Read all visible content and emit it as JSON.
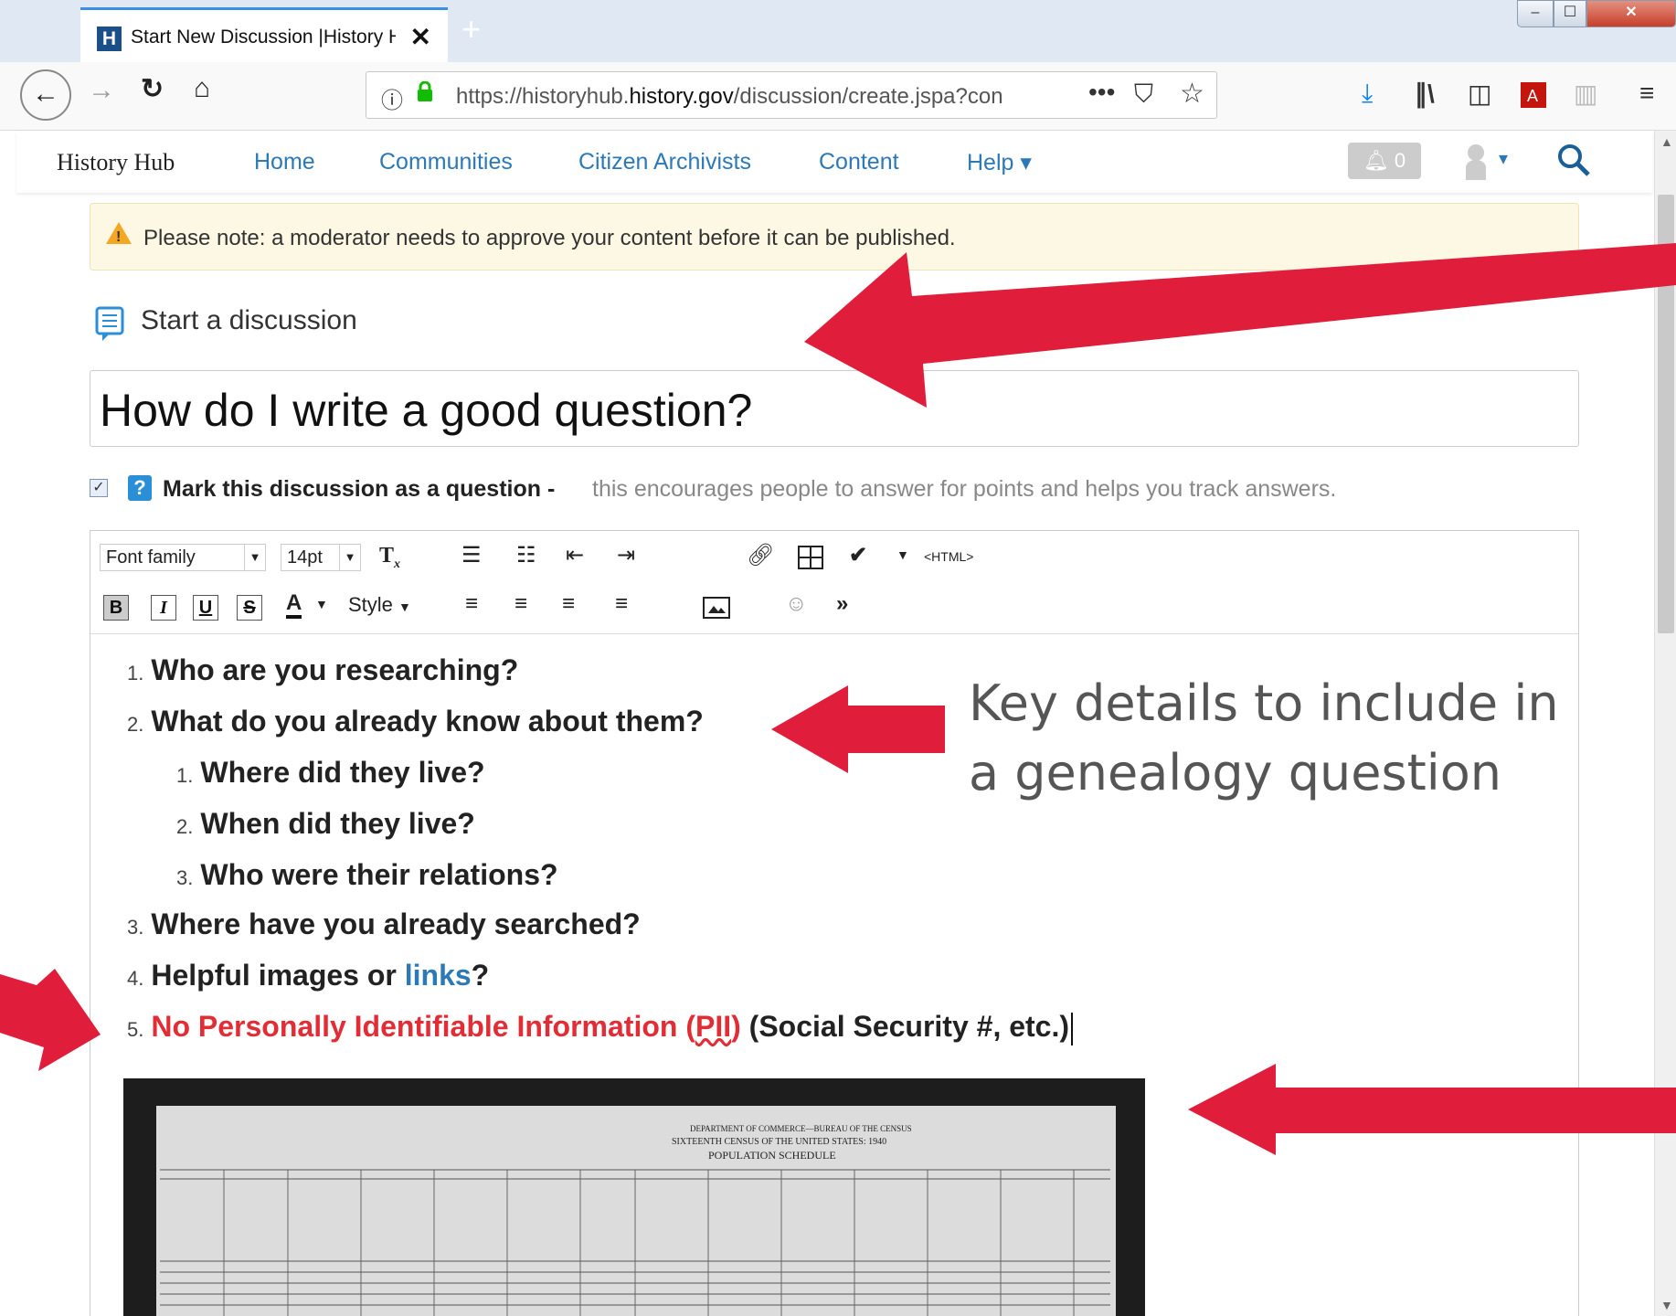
{
  "browser": {
    "tab_title": "Start New Discussion |History Hub",
    "favicon_letter": "H",
    "tab_close": "✕",
    "new_tab": "+",
    "window_controls": [
      "–",
      "☐",
      "✕"
    ],
    "url_prefix": "https://historyhub.",
    "url_domain": "history.gov",
    "url_path": "/discussion/create.jspa?con",
    "icons": [
      "back-icon",
      "forward-icon",
      "reload-icon",
      "home-icon",
      "info-icon",
      "lock-icon",
      "more-icon",
      "pocket-icon",
      "star-icon",
      "download-icon",
      "library-icon",
      "sidebar-icon",
      "pdf-icon",
      "reader-icon",
      "menu-icon"
    ]
  },
  "site": {
    "brand": "History Hub",
    "nav": [
      "Home",
      "Communities",
      "Citizen Archivists",
      "Content",
      "Help"
    ],
    "notifications": "0"
  },
  "notice": "Please note: a moderator needs to approve your content before it can be published.",
  "section_title": "Start a discussion",
  "subject": "How do I write a good question?",
  "question_checkbox": {
    "checked": true,
    "label": "Mark this discussion as a question -",
    "hint": "this encourages people to answer for points and helps you track answers."
  },
  "toolbar": {
    "font_family": "Font family",
    "font_size": "14pt",
    "style": "Style",
    "html": "<HTML>",
    "format_buttons": [
      "B",
      "I",
      "U",
      "S"
    ]
  },
  "list": {
    "n1": "1.",
    "i1": "Who are you researching?",
    "n2": "2.",
    "i2": "What do you already know about them?",
    "s1n": "1.",
    "s1": "Where did they live?",
    "s2n": "2.",
    "s2": "When did they live?",
    "s3n": "3.",
    "s3": "Who were their relations?",
    "n3": "3.",
    "i3": "Where have you already searched?",
    "n4": "4.",
    "i4a": "Helpful images or ",
    "i4link": "links",
    "i4b": "?",
    "n5": "5.",
    "i5a": "No Personally Identifiable Information (",
    "i5pii": "PII",
    "i5b": ")",
    "i5c": " (Social Security #, etc.)"
  },
  "callout_line1": "Key details to include in",
  "callout_line2": "a genealogy question",
  "census": {
    "header1": "DEPARTMENT OF COMMERCE—BUREAU OF THE CENSUS",
    "header2": "SIXTEENTH CENSUS OF THE UNITED STATES: 1940",
    "header3": "POPULATION SCHEDULE"
  },
  "colors": {
    "arrow": "#e01e3c",
    "link": "#2c79b8",
    "pii": "#e32d36"
  }
}
